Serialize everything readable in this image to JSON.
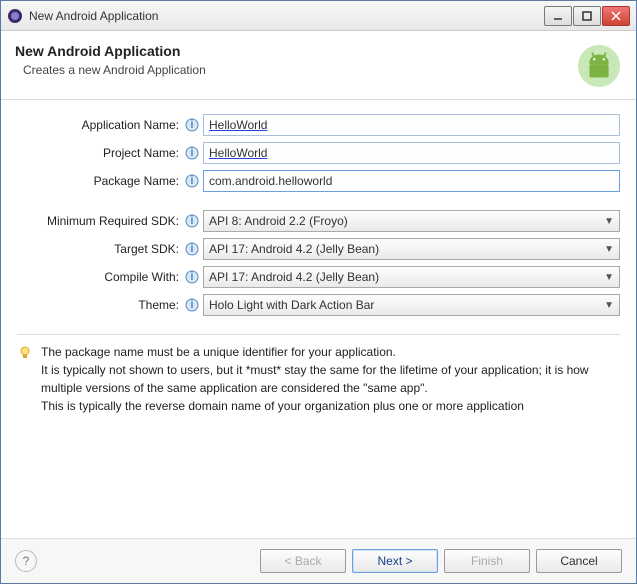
{
  "window": {
    "title": "New Android Application"
  },
  "header": {
    "title": "New Android Application",
    "subtitle": "Creates a new Android Application"
  },
  "form": {
    "appName": {
      "label": "Application Name:",
      "value": "HelloWorld"
    },
    "projName": {
      "label": "Project Name:",
      "value": "HelloWorld"
    },
    "pkgName": {
      "label": "Package Name:",
      "value": "com.android.helloworld"
    },
    "minSdk": {
      "label": "Minimum Required SDK:",
      "value": "API 8: Android 2.2 (Froyo)"
    },
    "targetSdk": {
      "label": "Target SDK:",
      "value": "API 17: Android 4.2 (Jelly Bean)"
    },
    "compile": {
      "label": "Compile With:",
      "value": "API 17: Android 4.2 (Jelly Bean)"
    },
    "theme": {
      "label": "Theme:",
      "value": "Holo Light with Dark Action Bar"
    }
  },
  "hint": {
    "line1": "The package name must be a unique identifier for your application.",
    "line2": "It is typically not shown to users, but it *must* stay the same for the lifetime of your application; it is how multiple versions of the same application are considered the \"same app\".",
    "line3": "This is typically the reverse domain name of your organization plus one or more application"
  },
  "footer": {
    "back": "< Back",
    "next": "Next >",
    "finish": "Finish",
    "cancel": "Cancel",
    "help": "?"
  }
}
